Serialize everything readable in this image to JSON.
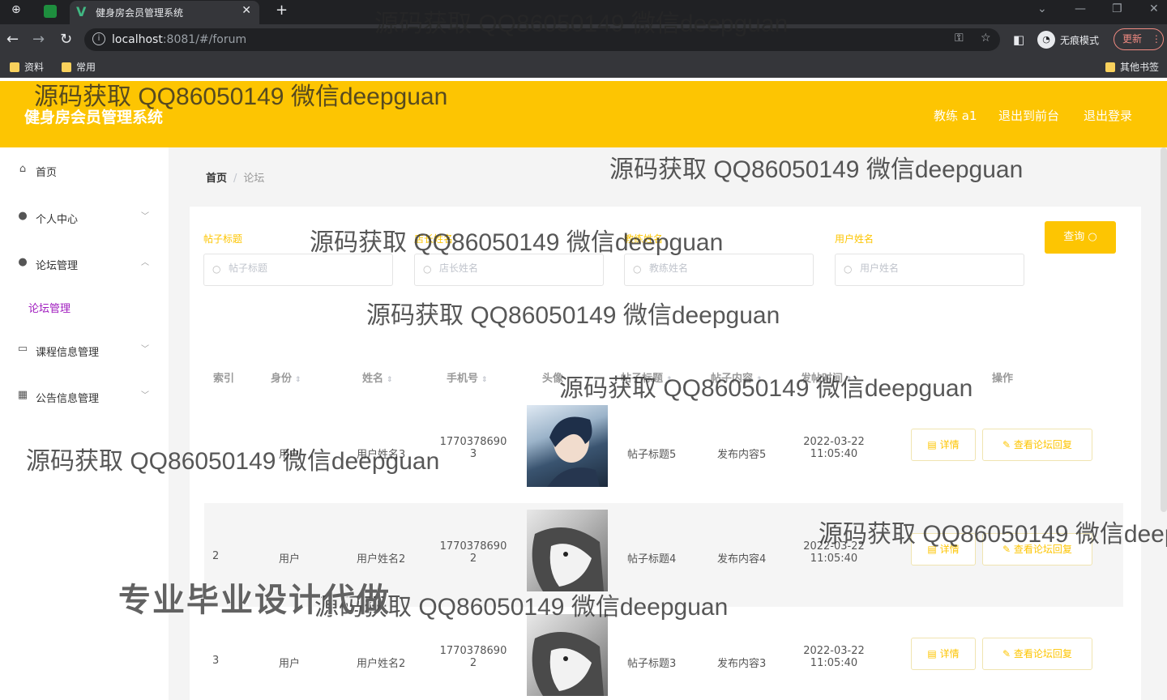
{
  "browser": {
    "tab_title": "健身房会员管理系统",
    "url_host": "localhost",
    "url_rest": ":8081/#/forum",
    "incognito_label": "无痕模式",
    "update_label": "更新",
    "bookmarks": [
      "资料",
      "常用"
    ],
    "other_bookmarks": "其他书签"
  },
  "header": {
    "title": "健身房会员管理系统",
    "user": "教练 a1",
    "to_front": "退出到前台",
    "logout": "退出登录"
  },
  "sidebar": {
    "items": [
      {
        "label": "首页",
        "icon": "home-icon"
      },
      {
        "label": "个人中心",
        "icon": "user-icon"
      },
      {
        "label": "论坛管理",
        "icon": "user-icon"
      },
      {
        "label": "课程信息管理",
        "icon": "card-icon"
      },
      {
        "label": "公告信息管理",
        "icon": "grid-icon"
      }
    ],
    "sub_item": "论坛管理"
  },
  "breadcrumb": {
    "home": "首页",
    "current": "论坛"
  },
  "search": {
    "fields": [
      {
        "label": "帖子标题",
        "placeholder": "帖子标题"
      },
      {
        "label": "店长姓名",
        "placeholder": "店长姓名"
      },
      {
        "label": "教练姓名",
        "placeholder": "教练姓名"
      },
      {
        "label": "用户姓名",
        "placeholder": "用户姓名"
      }
    ],
    "button": "查询"
  },
  "table": {
    "headers": [
      "索引",
      "身份",
      "姓名",
      "手机号",
      "头像",
      "帖子标题",
      "帖子内容",
      "发帖时间",
      "操作"
    ],
    "rows": [
      {
        "index": "",
        "identity": "用户",
        "name": "用户姓名3",
        "phone1": "1770378690",
        "phone2": "3",
        "title": "帖子标题5",
        "content": "发布内容5",
        "date": "2022-03-22",
        "time": "11:05:40"
      },
      {
        "index": "2",
        "identity": "用户",
        "name": "用户姓名2",
        "phone1": "1770378690",
        "phone2": "2",
        "title": "帖子标题4",
        "content": "发布内容4",
        "date": "2022-03-22",
        "time": "11:05:40"
      },
      {
        "index": "3",
        "identity": "用户",
        "name": "用户姓名2",
        "phone1": "1770378690",
        "phone2": "2",
        "title": "帖子标题3",
        "content": "发布内容3",
        "date": "2022-03-22",
        "time": "11:05:40"
      }
    ],
    "detail_label": "详情",
    "reply_label": "查看论坛回复"
  },
  "watermark": "源码获取 QQ86050149 微信deepguan",
  "promo": "专业毕业设计代做",
  "colors": {
    "accent": "#fdc502",
    "sub_active": "#a01dbf"
  }
}
